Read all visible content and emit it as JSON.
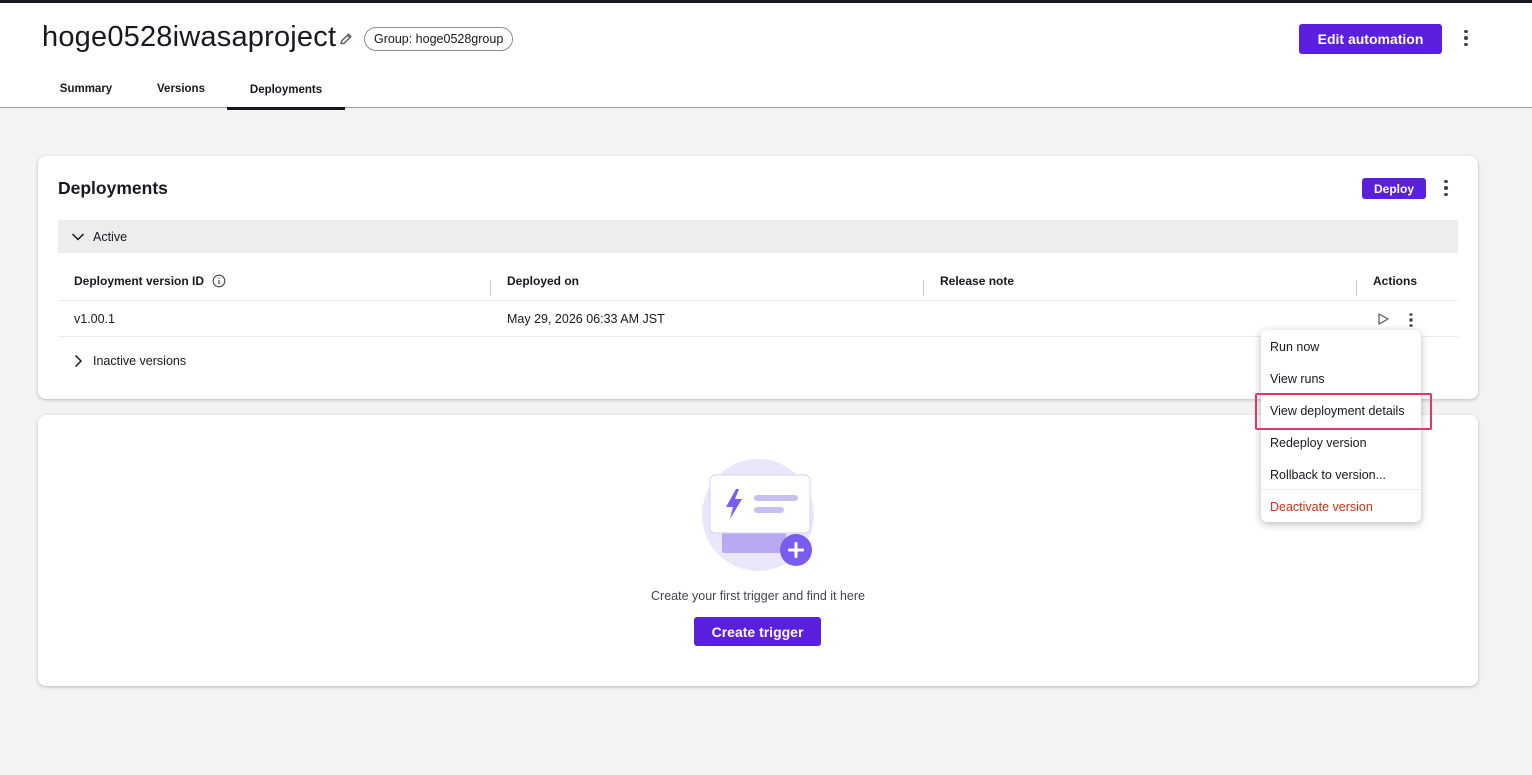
{
  "header": {
    "project_title": "hoge0528iwasaproject",
    "group_label": "Group: hoge0528group",
    "edit_automation_label": "Edit automation"
  },
  "tabs": [
    {
      "label": "Summary",
      "selected": false
    },
    {
      "label": "Versions",
      "selected": false
    },
    {
      "label": "Deployments",
      "selected": true
    }
  ],
  "deployments": {
    "title": "Deployments",
    "deploy_label": "Deploy",
    "active_section_label": "Active",
    "columns": [
      "Deployment version ID",
      "Deployed on",
      "Release note",
      "Actions"
    ],
    "rows": [
      {
        "version_id": "v1.00.1",
        "deployed_on": "May 29, 2026 06:33 AM JST",
        "release_note": ""
      }
    ],
    "inactive_section_label": "Inactive versions"
  },
  "empty_state": {
    "message": "Create your first trigger and find it here",
    "button_label": "Create trigger"
  },
  "actions_menu": {
    "items": [
      {
        "label": "Run now"
      },
      {
        "label": "View runs"
      },
      {
        "label": "View deployment details",
        "highlighted": true
      },
      {
        "label": "Redeploy version"
      },
      {
        "label": "Rollback to version..."
      },
      {
        "label": "Deactivate version",
        "danger": true
      }
    ]
  },
  "icons": {
    "edit": "pencil-icon",
    "info": "info-icon",
    "chevron_down": "chevron-down-icon",
    "chevron_right": "chevron-right-icon",
    "play": "play-icon",
    "more": "more-vertical-icon"
  },
  "colors": {
    "primary": "#5b1fe0",
    "danger": "#d13212",
    "highlight_box": "#e8336f",
    "illustration_accent": "#7b5cf0"
  }
}
